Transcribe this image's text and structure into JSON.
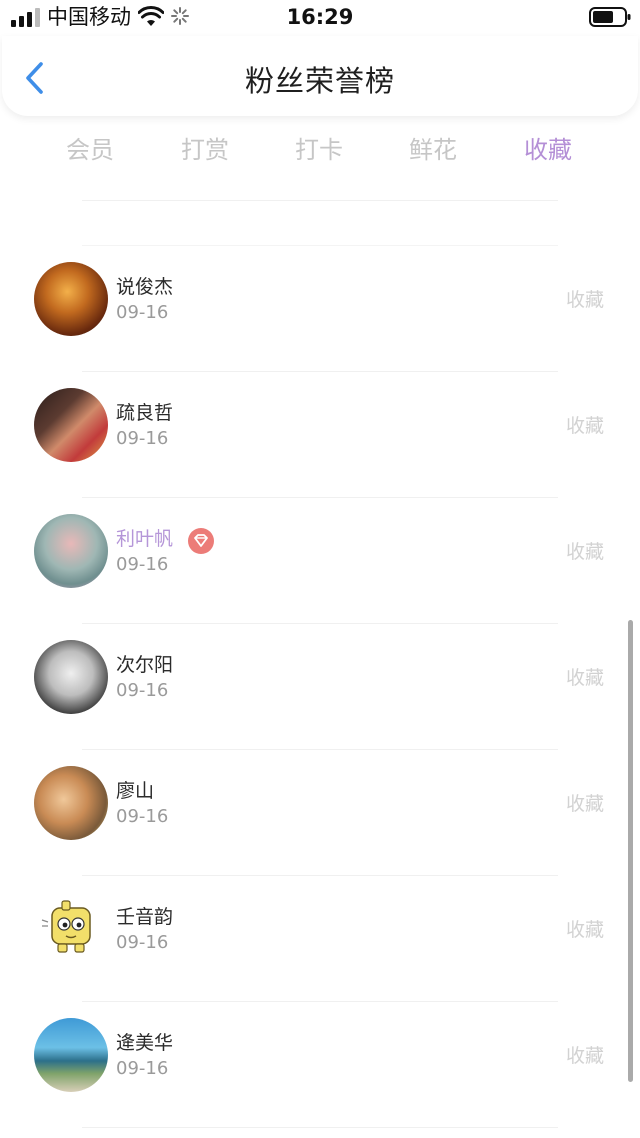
{
  "status_bar": {
    "carrier": "中国移动",
    "time": "16:29",
    "icons": [
      "signal-icon",
      "wifi-icon",
      "loading-spinner-icon",
      "battery-icon"
    ]
  },
  "header": {
    "back_icon": "chevron-left-icon",
    "title": "粉丝荣誉榜"
  },
  "tabs": [
    {
      "label": "会员",
      "active": false
    },
    {
      "label": "打赏",
      "active": false
    },
    {
      "label": "打卡",
      "active": false
    },
    {
      "label": "鲜花",
      "active": false
    },
    {
      "label": "收藏",
      "active": true
    }
  ],
  "list": {
    "items": [
      {
        "name": "说俊杰",
        "date": "09-16",
        "action": "收藏",
        "vip": false
      },
      {
        "name": "疏良哲",
        "date": "09-16",
        "action": "收藏",
        "vip": false
      },
      {
        "name": "利叶帆",
        "date": "09-16",
        "action": "收藏",
        "vip": true
      },
      {
        "name": "次尔阳",
        "date": "09-16",
        "action": "收藏",
        "vip": false
      },
      {
        "name": "廖山",
        "date": "09-16",
        "action": "收藏",
        "vip": false
      },
      {
        "name": "壬音韵",
        "date": "09-16",
        "action": "收藏",
        "vip": false
      },
      {
        "name": "逄美华",
        "date": "09-16",
        "action": "收藏",
        "vip": false
      }
    ]
  },
  "colors": {
    "accent": "#b48fd6",
    "vip_name": "#b596d8",
    "vip_badge": "#ec7c78",
    "tab_inactive": "#c6c6c6",
    "action_text": "#d2d2d2"
  }
}
